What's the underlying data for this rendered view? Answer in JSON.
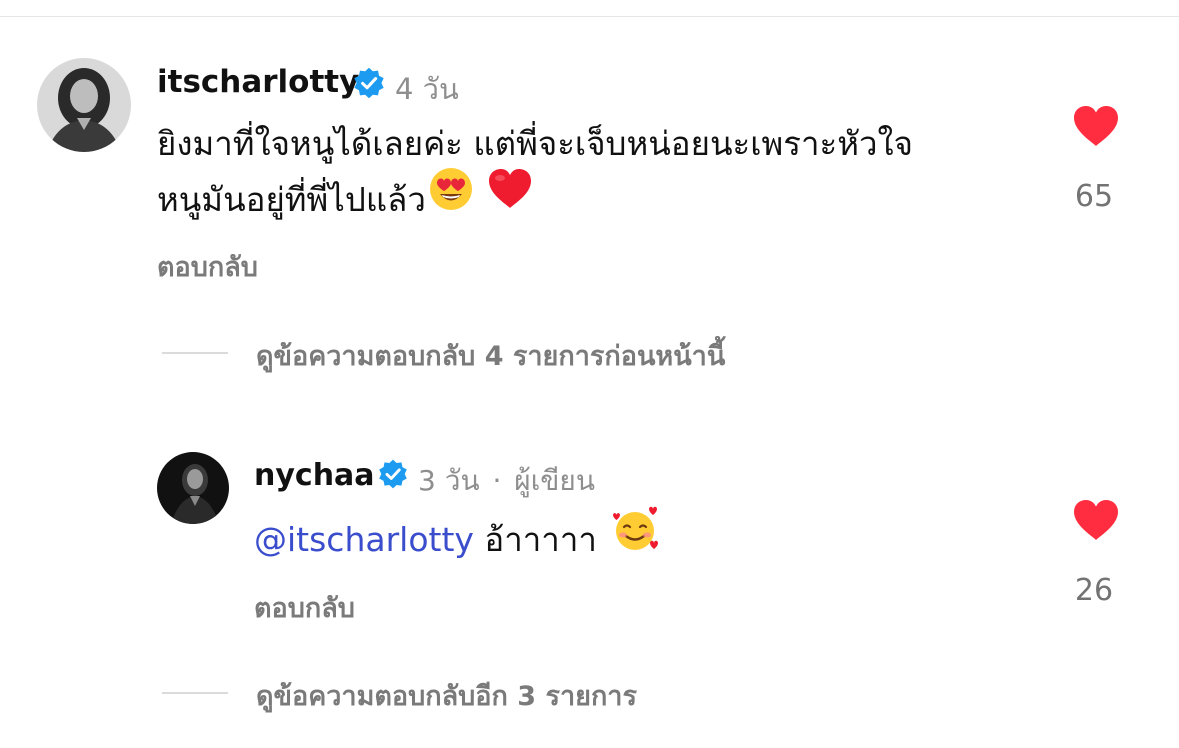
{
  "colors": {
    "verified": "#1d9bf0",
    "heart": "#ff2d3f",
    "mention": "#3a4dcc",
    "muted": "#7a7a7a"
  },
  "comment": {
    "username": "itscharlotty",
    "time": "4 วัน",
    "line1": "ยิงมาที่ใจหนูได้เลยค่ะ แต่พี่จะเจ็บหน่อยนะเพราะหัวใจ",
    "line2": "หนูมันอยู่ที่พี่ไปแล้ว",
    "emojis": [
      "heart-eyes-emoji",
      "red-heart-emoji"
    ],
    "reply_label": "ตอบกลับ",
    "likes": "65"
  },
  "view_previous": "ดูข้อความตอบกลับ 4 รายการก่อนหน้านี้",
  "reply": {
    "username": "nychaa",
    "time": "3 วัน",
    "separator": "·",
    "author_label": "ผู้เขียน",
    "mention": "@itscharlotty",
    "text": "อ้าาาาา",
    "emoji": "smiling-face-with-hearts-emoji",
    "reply_label": "ตอบกลับ",
    "likes": "26"
  },
  "view_more": "ดูข้อความตอบกลับอีก 3 รายการ"
}
